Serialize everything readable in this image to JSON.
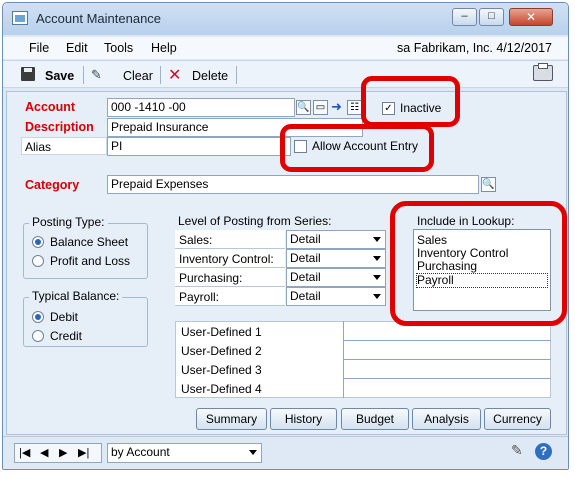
{
  "window": {
    "title": "Account Maintenance",
    "minimize": "–",
    "maximize": "□",
    "close": "✕"
  },
  "menu": {
    "items": [
      "File",
      "Edit",
      "Tools",
      "Help"
    ],
    "company": "sa  Fabrikam, Inc.  4/12/2017"
  },
  "toolbar": {
    "save": "Save",
    "clear": "Clear",
    "delete": "Delete"
  },
  "form": {
    "account_label": "Account",
    "account_value": "000 -1410 -00",
    "description_label": "Description",
    "description_value": "Prepaid Insurance",
    "alias_label": "Alias",
    "alias_value": "PI",
    "inactive_label": "Inactive",
    "inactive_checked": "✓",
    "allow_entry_label": "Allow Account Entry",
    "category_label": "Category",
    "category_value": "Prepaid Expenses"
  },
  "posting_type": {
    "title": "Posting Type:",
    "options": [
      "Balance Sheet",
      "Profit and Loss"
    ],
    "selected": "Balance Sheet"
  },
  "typical_balance": {
    "title": "Typical Balance:",
    "options": [
      "Debit",
      "Credit"
    ],
    "selected": "Debit"
  },
  "level_of_posting": {
    "title": "Level of Posting from Series:",
    "rows": [
      {
        "label": "Sales:",
        "value": "Detail"
      },
      {
        "label": "Inventory Control:",
        "value": "Detail"
      },
      {
        "label": "Purchasing:",
        "value": "Detail"
      },
      {
        "label": "Payroll:",
        "value": "Detail"
      }
    ]
  },
  "lookup": {
    "title": "Include in Lookup:",
    "items": [
      "Sales",
      "Inventory Control",
      "Purchasing",
      "Payroll"
    ]
  },
  "user_defined": [
    "User-Defined 1",
    "User-Defined 2",
    "User-Defined 3",
    "User-Defined 4"
  ],
  "buttons": [
    "Summary",
    "History",
    "Budget",
    "Analysis",
    "Currency"
  ],
  "status": {
    "sort_by": "by Account",
    "nav": [
      "|◀",
      "◀",
      "▶",
      "▶|"
    ]
  },
  "colors": {
    "highlight": "#e00000",
    "label_red": "#d30000"
  }
}
